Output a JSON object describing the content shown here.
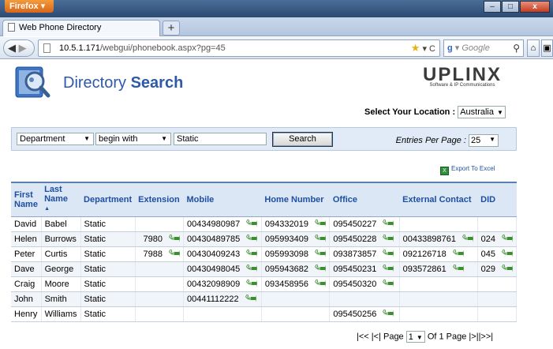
{
  "browser": {
    "app_button": "Firefox",
    "tab_title": "Web Phone Directory",
    "new_tab": "+",
    "url_host": "10.5.1.171",
    "url_path": "/webgui/phonebook.aspx?pg=45",
    "search_engine": "Google",
    "win_min": "–",
    "win_max": "□",
    "win_close": "x"
  },
  "page": {
    "title_light": "Directory",
    "title_bold": "Search",
    "brand_mark": "UPLINX",
    "brand_tagline": "Software & IP Communications",
    "location_label": "Select Your Location :",
    "location_value": "Australia",
    "export_label": "Export To Excel"
  },
  "search": {
    "field": "Department",
    "operator": "begin with",
    "query": "Static",
    "button": "Search",
    "entries_label": "Entries Per Page :",
    "entries_value": "25"
  },
  "table": {
    "headers": {
      "first": "First Name",
      "last": "Last Name",
      "department": "Department",
      "extension": "Extension",
      "mobile": "Mobile",
      "home": "Home Number",
      "office": "Office",
      "external": "External Contact",
      "did": "DID"
    },
    "rows": [
      {
        "first": "David",
        "last": "Babel",
        "department": "Static",
        "extension": "",
        "mobile": "00434980987",
        "home": "094332019",
        "office": "095450227",
        "external": "",
        "did": ""
      },
      {
        "first": "Helen",
        "last": "Burrows",
        "department": "Static",
        "extension": "7980",
        "mobile": "00430489785",
        "home": "095993409",
        "office": "095450228",
        "external": "00433898761",
        "did": "024"
      },
      {
        "first": "Peter",
        "last": "Curtis",
        "department": "Static",
        "extension": "7988",
        "mobile": "00430409243",
        "home": "095993098",
        "office": "093873857",
        "external": "092126718",
        "did": "045"
      },
      {
        "first": "Dave",
        "last": "George",
        "department": "Static",
        "extension": "",
        "mobile": "00430498045",
        "home": "095943682",
        "office": "095450231",
        "external": "093572861",
        "did": "029"
      },
      {
        "first": "Craig",
        "last": "Moore",
        "department": "Static",
        "extension": "",
        "mobile": "00432098909",
        "home": "093458956",
        "office": "095450320",
        "external": "",
        "did": ""
      },
      {
        "first": "John",
        "last": "Smith",
        "department": "Static",
        "extension": "",
        "mobile": "00441112222",
        "home": "",
        "office": "",
        "external": "",
        "did": ""
      },
      {
        "first": "Henry",
        "last": "Williams",
        "department": "Static",
        "extension": "",
        "mobile": "",
        "home": "",
        "office": "095450256",
        "external": "",
        "did": ""
      }
    ]
  },
  "pager": {
    "first": "|<<",
    "prev": "|<|",
    "page_label": "Page",
    "page_value": "1",
    "of_label": "Of 1 Page",
    "next": "|>|",
    "last": "|>>|"
  },
  "colors": {
    "header_text": "#1f4fa0",
    "title_blue": "#2d5aa8",
    "dial_green": "#3a8f2f"
  },
  "icons": {
    "dial": "dial-phone-arrow-icon",
    "sort": "sort-ascending-icon"
  }
}
